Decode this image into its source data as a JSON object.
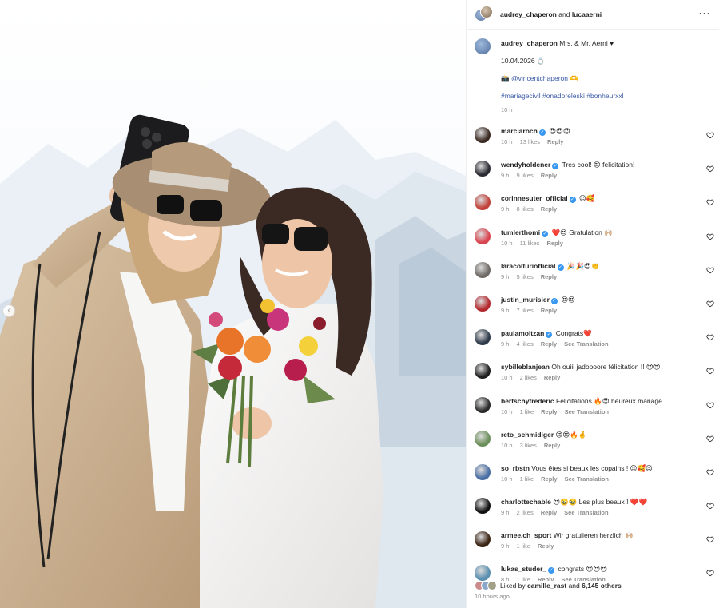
{
  "header": {
    "user1": "audrey_chaperon",
    "and": "and",
    "user2": "lucaaerni"
  },
  "caption": {
    "username": "audrey_chaperon",
    "text": "Mrs. & Mr. Aerni ♥",
    "date": "10.04.2026 💍",
    "credit_prefix": "📸",
    "credit_link": "@vincentchaperon",
    "credit_suffix": "🫶",
    "hashtags": "#mariagecivil #onadoreleski #bonheurxxl",
    "time": "10 h"
  },
  "comments": [
    {
      "user": "marclaroch",
      "verified": true,
      "text": "😍😍😍",
      "time": "10 h",
      "likes": "13 likes",
      "reply": "Reply",
      "translate": "",
      "avatar_color": "#3b2a22"
    },
    {
      "user": "wendyholdener",
      "verified": true,
      "text": "Tres cool! 😍 felicitation!",
      "time": "9 h",
      "likes": "9 likes",
      "reply": "Reply",
      "translate": "",
      "avatar_color": "#2b2b33"
    },
    {
      "user": "corinnesuter_official",
      "verified": true,
      "text": "😍🥰",
      "time": "9 h",
      "likes": "8 likes",
      "reply": "Reply",
      "translate": "",
      "avatar_color": "#c2413a"
    },
    {
      "user": "tumlerthomi",
      "verified": true,
      "text": "❤️😍 Gratulation 🙌🏼",
      "time": "10 h",
      "likes": "11 likes",
      "reply": "Reply",
      "translate": "",
      "avatar_color": "#d9434e"
    },
    {
      "user": "laracolturiofficial",
      "verified": true,
      "text": "🎉🎉😍👏",
      "time": "9 h",
      "likes": "5 likes",
      "reply": "Reply",
      "translate": "",
      "avatar_color": "#6f6a66"
    },
    {
      "user": "justin_murisier",
      "verified": true,
      "text": "😍😍",
      "time": "9 h",
      "likes": "7 likes",
      "reply": "Reply",
      "translate": "",
      "avatar_color": "#b3282d"
    },
    {
      "user": "paulamoltzan",
      "verified": true,
      "text": "Congrats❤️",
      "time": "9 h",
      "likes": "4 likes",
      "reply": "Reply",
      "translate": "See Translation",
      "avatar_color": "#2e3a4a"
    },
    {
      "user": "sybilleblanjean",
      "verified": false,
      "text": "Oh ouiii jadoooore félicitation !! 😍😍",
      "time": "10 h",
      "likes": "2 likes",
      "reply": "Reply",
      "translate": "",
      "avatar_color": "#1f1f1f"
    },
    {
      "user": "bertschyfrederic",
      "verified": false,
      "text": "Félicitations 🔥😍 heureux mariage",
      "time": "10 h",
      "likes": "1 like",
      "reply": "Reply",
      "translate": "See Translation",
      "avatar_color": "#2a2a2a"
    },
    {
      "user": "reto_schmidiger",
      "verified": false,
      "text": "😍😍🔥🤞",
      "time": "10 h",
      "likes": "3 likes",
      "reply": "Reply",
      "translate": "",
      "avatar_color": "#6b8f5a"
    },
    {
      "user": "so_rbstn",
      "verified": false,
      "text": "Vous êtes si beaux les copains ! 😍🥰😍",
      "time": "10 h",
      "likes": "1 like",
      "reply": "Reply",
      "translate": "See Translation",
      "avatar_color": "#4a6fa5"
    },
    {
      "user": "charlottechable",
      "verified": false,
      "text": "😍🥹🥹 Les plus beaux ! ❤️❤️",
      "time": "9 h",
      "likes": "2 likes",
      "reply": "Reply",
      "translate": "See Translation",
      "avatar_color": "#111111"
    },
    {
      "user": "armee.ch_sport",
      "verified": false,
      "text": "Wir gratulieren herzlich 🙌🏼",
      "time": "9 h",
      "likes": "1 like",
      "reply": "Reply",
      "translate": "",
      "avatar_color": "#3b2314"
    },
    {
      "user": "lukas_studer_",
      "verified": true,
      "text": "congrats 😍😍😍",
      "time": "8 h",
      "likes": "1 like",
      "reply": "Reply",
      "translate": "See Translation",
      "avatar_color": "#5a8fb0"
    }
  ],
  "footer": {
    "liked_by": "Liked by",
    "liker": "camille_rast",
    "and": "and",
    "others": "6,145 others",
    "ago": "10 hours ago"
  },
  "photo": {
    "alt": "Two women taking a selfie in the snowy mountains, one holding a flower bouquet"
  }
}
